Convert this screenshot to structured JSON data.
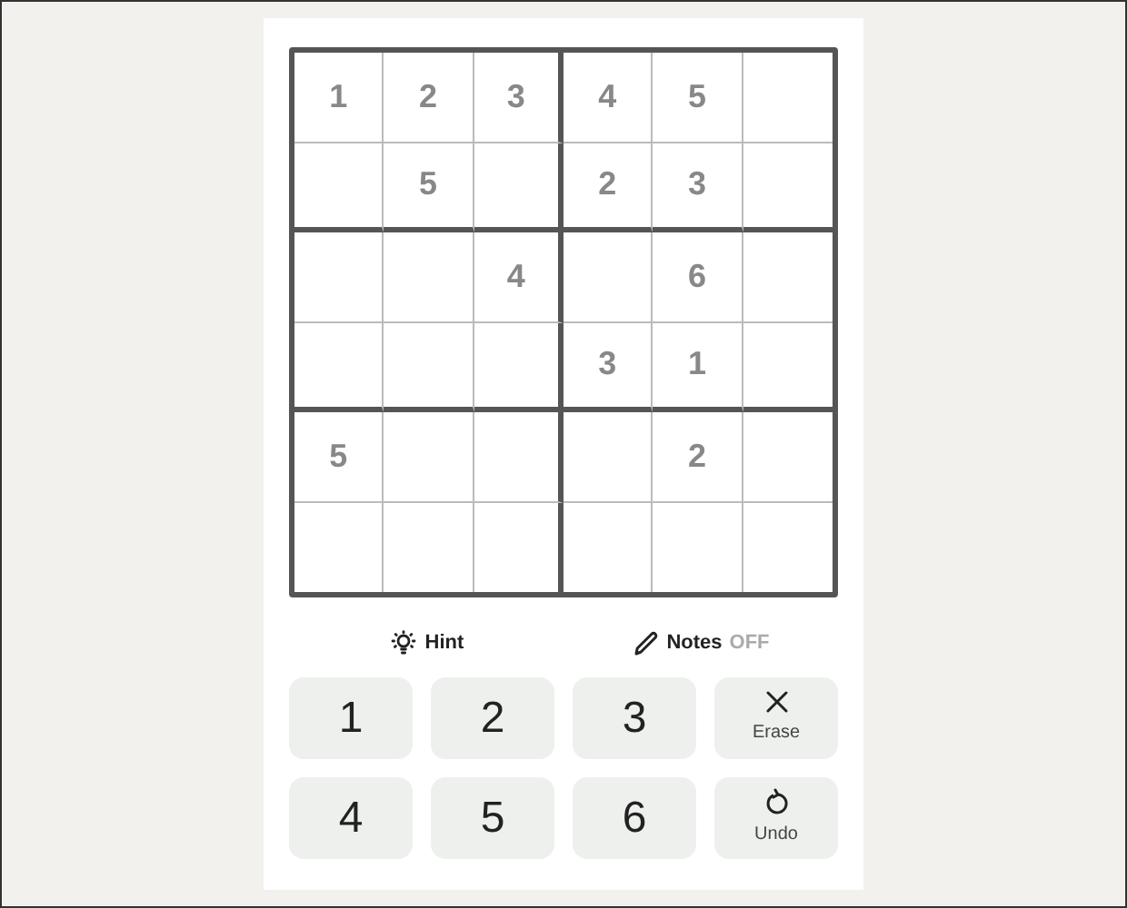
{
  "grid": {
    "rows": [
      [
        "1",
        "2",
        "3",
        "4",
        "5",
        null
      ],
      [
        null,
        "5",
        null,
        "2",
        "3",
        null
      ],
      [
        null,
        null,
        "4",
        null,
        "6",
        null
      ],
      [
        null,
        null,
        null,
        "3",
        "1",
        null
      ],
      [
        "5",
        null,
        null,
        null,
        "2",
        null
      ],
      [
        null,
        null,
        null,
        null,
        null,
        null
      ]
    ]
  },
  "tools": {
    "hint": {
      "label": "Hint"
    },
    "notes": {
      "label": "Notes",
      "state_label": "OFF",
      "on": false
    }
  },
  "keypad": [
    {
      "kind": "digit",
      "label": "1"
    },
    {
      "kind": "digit",
      "label": "2"
    },
    {
      "kind": "digit",
      "label": "3"
    },
    {
      "kind": "erase",
      "label": "Erase"
    },
    {
      "kind": "digit",
      "label": "4"
    },
    {
      "kind": "digit",
      "label": "5"
    },
    {
      "kind": "digit",
      "label": "6"
    },
    {
      "kind": "undo",
      "label": "Undo"
    }
  ]
}
